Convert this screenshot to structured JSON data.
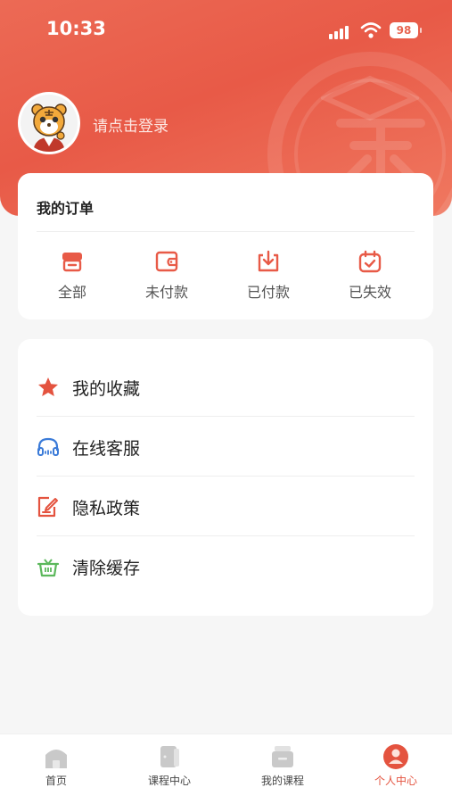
{
  "status_bar": {
    "time": "10:33",
    "battery": "98"
  },
  "profile": {
    "login_prompt": "请点击登录"
  },
  "orders": {
    "title": "我的订单",
    "items": [
      {
        "label": "全部",
        "icon": "store-icon"
      },
      {
        "label": "未付款",
        "icon": "wallet-icon"
      },
      {
        "label": "已付款",
        "icon": "download-icon"
      },
      {
        "label": "已失效",
        "icon": "calendar-check-icon"
      }
    ]
  },
  "menu": {
    "items": [
      {
        "label": "我的收藏",
        "icon": "star-icon",
        "color": "#e4533f"
      },
      {
        "label": "在线客服",
        "icon": "headset-icon",
        "color": "#3b7bd8"
      },
      {
        "label": "隐私政策",
        "icon": "edit-doc-icon",
        "color": "#e4533f"
      },
      {
        "label": "清除缓存",
        "icon": "basket-icon",
        "color": "#5cb85c"
      }
    ]
  },
  "tabbar": {
    "items": [
      {
        "label": "首页",
        "icon": "home-icon"
      },
      {
        "label": "课程中心",
        "icon": "course-center-icon"
      },
      {
        "label": "我的课程",
        "icon": "my-courses-icon"
      },
      {
        "label": "个人中心",
        "icon": "profile-icon"
      }
    ],
    "active_color": "#e4533f"
  },
  "colors": {
    "accent": "#e85a47",
    "background": "#f6f6f6"
  }
}
